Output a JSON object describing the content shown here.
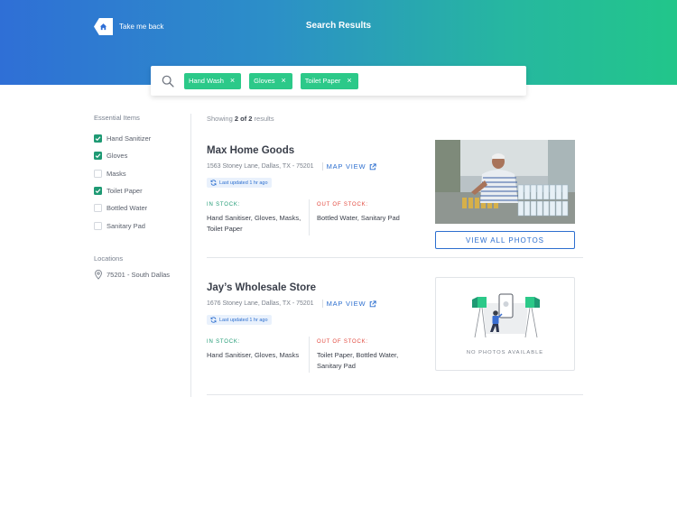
{
  "header": {
    "back_label": "Take me back",
    "title": "Search Results",
    "gradient_start": "#2f6fd6",
    "gradient_end": "#22c68a"
  },
  "search": {
    "icon": "search-icon",
    "chips": [
      {
        "label": "Hand Wash"
      },
      {
        "label": "Gloves"
      },
      {
        "label": "Toilet Paper"
      }
    ]
  },
  "sidebar": {
    "essential_heading": "Essential Items",
    "items": [
      {
        "label": "Hand Sanitizer",
        "checked": true
      },
      {
        "label": "Gloves",
        "checked": true
      },
      {
        "label": "Masks",
        "checked": false
      },
      {
        "label": "Toilet Paper",
        "checked": true
      },
      {
        "label": "Bottled Water",
        "checked": false
      },
      {
        "label": "Sanitary Pad",
        "checked": false
      }
    ],
    "locations_heading": "Locations",
    "location": "75201 - South Dallas"
  },
  "results": {
    "prefix": "Showing ",
    "shown": "2 of 2",
    "suffix": " results"
  },
  "stores": [
    {
      "name": "Max Home Goods",
      "address": "1563 Stoney Lane, Dallas, TX - 75201",
      "map_label": "MAP VIEW",
      "updated": "Last updated 1 hr ago",
      "in_label": "IN STOCK:",
      "in_stock": "Hand Sanitiser, Gloves, Masks, Toilet Paper",
      "out_label": "OUT OF STOCK:",
      "out_stock": "Bottled Water, Sanitary Pad",
      "photos_button": "VIEW ALL PHOTOS"
    },
    {
      "name": "Jay’s Wholesale Store",
      "address": "1676 Stoney Lane, Dallas, TX - 75201",
      "map_label": "MAP VIEW",
      "updated": "Last updated 1 hr ago",
      "in_label": "IN STOCK:",
      "in_stock": "Hand Sanitiser, Gloves, Masks",
      "out_label": "OUT OF STOCK:",
      "out_stock": "Toilet Paper, Bottled Water, Sanitary Pad",
      "no_photos": "NO PHOTOS AVAILABLE"
    }
  ],
  "colors": {
    "accent_green": "#2cc989",
    "link_blue": "#2d6fcf",
    "in_stock": "#1f9a74",
    "out_of_stock": "#e2483d"
  }
}
